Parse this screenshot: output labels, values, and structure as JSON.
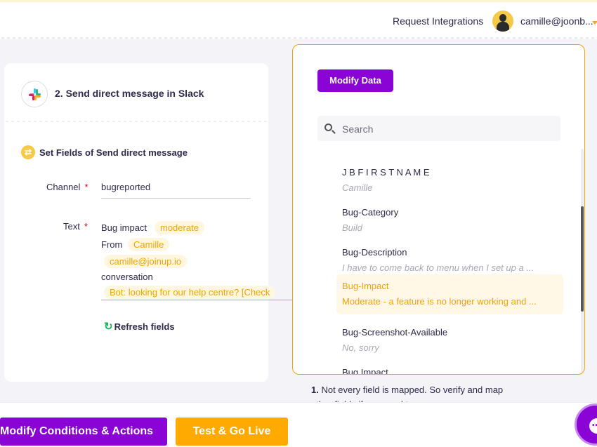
{
  "topbar": {
    "request_integrations": "Request Integrations",
    "user_email": "camille@joonb..."
  },
  "step": {
    "title": "2. Send direct message in Slack",
    "set_fields_title": "Set Fields of Send direct message"
  },
  "fields": {
    "channel_label": "Channel",
    "channel_value": "bugreported",
    "text_label": "Text",
    "required_mark": "*",
    "text_parts": {
      "bug_impact": "Bug impact",
      "chip_moderate": "moderate",
      "from": "From",
      "chip_camille": "Camille",
      "chip_email": "camille@joinup.io",
      "conversation": "conversation",
      "chip_bot": "Bot: looking for our help centre? [Check"
    },
    "refresh_label": "Refresh fields"
  },
  "panel": {
    "modify_data_label": "Modify Data",
    "search_placeholder": "Search",
    "items": [
      {
        "name": "J B F I R S T N A M E",
        "value": "Camille",
        "active": false
      },
      {
        "name": "Bug-Category",
        "value": "Build",
        "active": false
      },
      {
        "name": "Bug-Description",
        "value": "I have to come back to menu when I set up a ...",
        "active": false
      },
      {
        "name": "Bug-Impact",
        "value": "Moderate - a feature is no longer working and ...",
        "active": true
      },
      {
        "name": "Bug-Screenshot-Available",
        "value": "No, sorry",
        "active": false
      },
      {
        "name": "Bug Impact",
        "value": "",
        "active": false
      }
    ]
  },
  "note": {
    "number": "1.",
    "text": "Not every field is mapped. So verify and map other fields if you need to."
  },
  "bottom": {
    "modify_conditions_label": "Modify Conditions & Actions",
    "test_go_live_label": "Test & Go Live"
  },
  "colors": {
    "primary_purple": "#8a04d6",
    "accent_orange": "#ffaa00",
    "chip_text": "#f0a500"
  },
  "icons": [
    "slack-icon",
    "swap-icon",
    "refresh-icon",
    "search-icon",
    "chat-icon",
    "avatar-icon",
    "chevron-down-icon"
  ]
}
